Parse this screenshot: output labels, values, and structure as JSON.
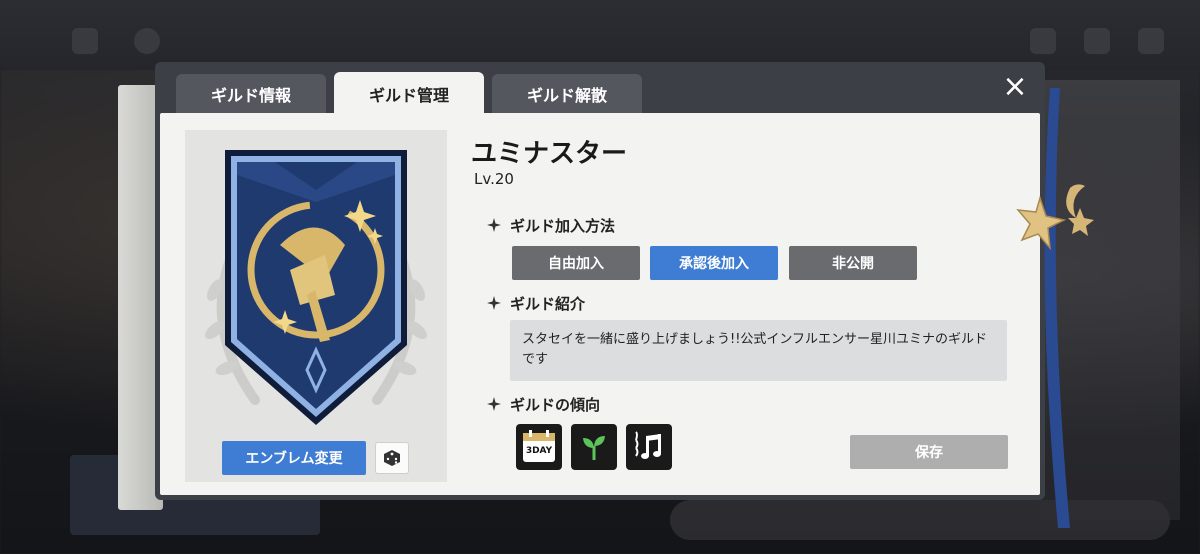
{
  "tabs": [
    {
      "label": "ギルド情報",
      "active": false
    },
    {
      "label": "ギルド管理",
      "active": true
    },
    {
      "label": "ギルド解散",
      "active": false
    }
  ],
  "close_icon": "×",
  "guild": {
    "name": "ユミナスター",
    "level": "Lv.20"
  },
  "emblem": {
    "change_label": "エンブレム変更",
    "dice_icon": "dice-icon"
  },
  "join_method": {
    "title": "ギルド加入方法",
    "options": [
      "自由加入",
      "承認後加入",
      "非公開"
    ],
    "selected": "承認後加入"
  },
  "intro": {
    "title": "ギルド紹介",
    "text": "スタセイを一緒に盛り上げましょう!!公式インフルエンサー星川ユミナのギルドです"
  },
  "tendency": {
    "title": "ギルドの傾向",
    "icons": [
      {
        "name": "calendar-3day-icon",
        "label": "3DAY"
      },
      {
        "name": "sprout-icon"
      },
      {
        "name": "music-note-icon"
      }
    ]
  },
  "save_label": "保存",
  "colors": {
    "accent": "#3f7cd3",
    "inactive_button": "#6a6b6e",
    "disabled_button": "#aeaeae",
    "emblem_navy": "#1f3a6e",
    "emblem_gold": "#d9b76a"
  }
}
